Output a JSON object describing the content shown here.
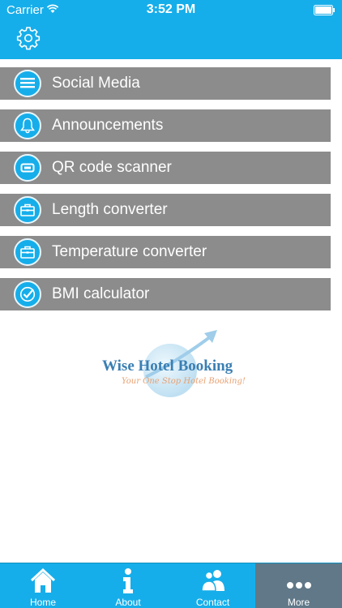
{
  "status_bar": {
    "carrier": "Carrier",
    "time": "3:52 PM"
  },
  "header": {
    "settings_icon": "gear-icon",
    "background_color": "#16aeea"
  },
  "menu": {
    "items": [
      {
        "label": "Social Media",
        "icon": "list-icon"
      },
      {
        "label": "Announcements",
        "icon": "bell-icon"
      },
      {
        "label": "QR code scanner",
        "icon": "scanner-icon"
      },
      {
        "label": "Length converter",
        "icon": "briefcase-icon"
      },
      {
        "label": "Temperature converter",
        "icon": "briefcase-icon"
      },
      {
        "label": "BMI calculator",
        "icon": "checkmark-icon"
      }
    ],
    "item_color": "#8c8c8c"
  },
  "logo": {
    "title": "Wise Hotel Booking",
    "tagline": "Your One Stop Hotel Booking!"
  },
  "tab_bar": {
    "tabs": [
      {
        "label": "Home",
        "icon": "home-icon"
      },
      {
        "label": "About",
        "icon": "info-icon"
      },
      {
        "label": "Contact",
        "icon": "contacts-icon"
      },
      {
        "label": "More",
        "icon": "more-icon"
      }
    ],
    "active_tab": "More",
    "active_color": "#607888"
  }
}
